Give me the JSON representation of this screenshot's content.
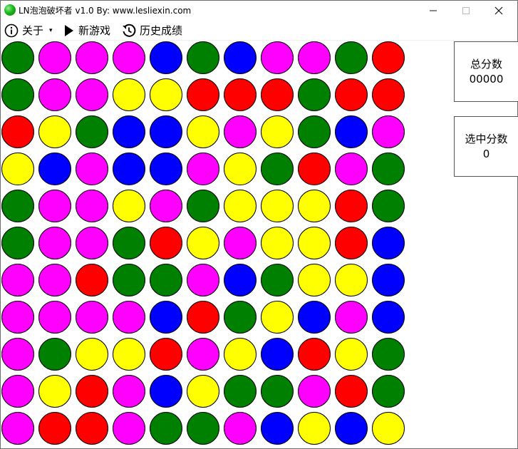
{
  "window": {
    "title": "LN泡泡破坏者 v1.0   By: www.lesliexin.com",
    "minimize_glyph": "—",
    "maximize_glyph": "☐",
    "close_glyph": "✕",
    "app_icon": "green-ball-icon"
  },
  "menu": {
    "about_label": "关于",
    "about_caret": "▾",
    "new_game_label": "新游戏",
    "history_label": "历史成绩",
    "icons": {
      "about": "info-icon",
      "new_game": "play-icon",
      "history": "history-icon"
    }
  },
  "scores": {
    "total_label": "总分数",
    "total_value": "00000",
    "selected_label": "选中分数",
    "selected_value": "0"
  },
  "colors": {
    "G": "#008000",
    "M": "#ff00ff",
    "B": "#0000ff",
    "R": "#ff0000",
    "Y": "#ffff00"
  },
  "board": {
    "rows": [
      "GMMMBGBMMGR",
      "GMMYYRRRGRR",
      "RYGBBYMYGBM",
      "YBMBBMYGRMG",
      "GMMYMGYYYRG",
      "GMMGRYMYYRB",
      "MMRGGMBGYYB",
      "MMMMBRGYBMB",
      "MGYYRMYBRYG",
      "MYRMBYGGMRG",
      "MRRMGGMBYBY"
    ]
  }
}
